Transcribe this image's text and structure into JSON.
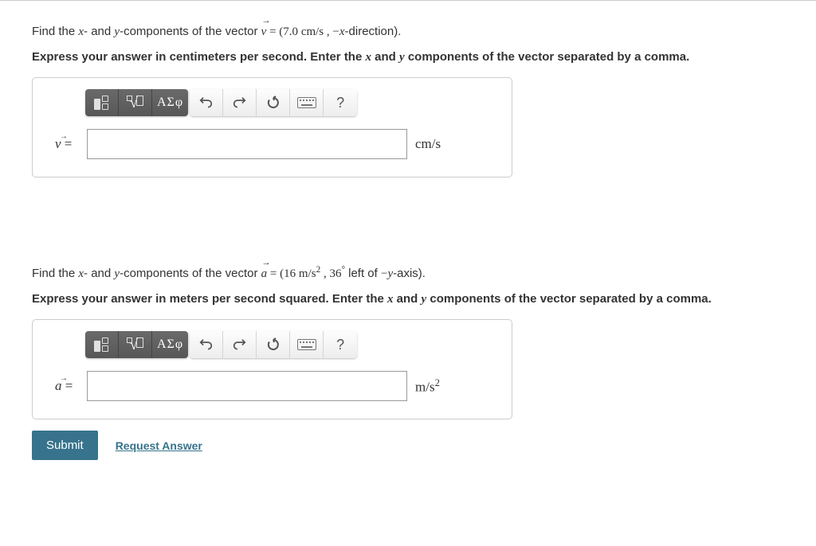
{
  "partA": {
    "prompt_pre": "Find the ",
    "x": "x",
    "dash_and": "- and ",
    "y": "y",
    "comp_of_vec": "-components of the vector ",
    "vec_sym": "v",
    "equals_open": " = (7.0 ",
    "unit_inline": "cm/s",
    "sep": " , ",
    "minus": "−",
    "dir_sym": "x",
    "dir_txt": "-direction).",
    "instr_pre": "Express your answer in centimeters per second. Enter the ",
    "instr_x": "x",
    "instr_and": " and ",
    "instr_y": "y",
    "instr_post": " components of the vector separated by a comma.",
    "var_label": "v",
    "unit_label": "cm/s"
  },
  "partB": {
    "prompt_pre": "Find the ",
    "x": "x",
    "dash_and": "- and ",
    "y": "y",
    "comp_of_vec": "-components of the vector ",
    "vec_sym": "a",
    "equals_open": " = (16 ",
    "unit_inline": "m/s",
    "unit_sup": "2",
    "sep": " , 36",
    "deg": "°",
    "left_of": "  left of ",
    "minus": "−",
    "dir_sym": "y",
    "dir_txt": "-axis).",
    "instr_pre": "Express your answer in meters per second squared. Enter the ",
    "instr_x": "x",
    "instr_and": " and ",
    "instr_y": "y",
    "instr_post": " components of the vector separated by a comma.",
    "var_label": "a",
    "unit_label": "m/s",
    "unit_sup2": "2"
  },
  "toolbar": {
    "greek": "ΑΣφ",
    "help": "?"
  },
  "actions": {
    "submit": "Submit",
    "request": "Request Answer"
  }
}
